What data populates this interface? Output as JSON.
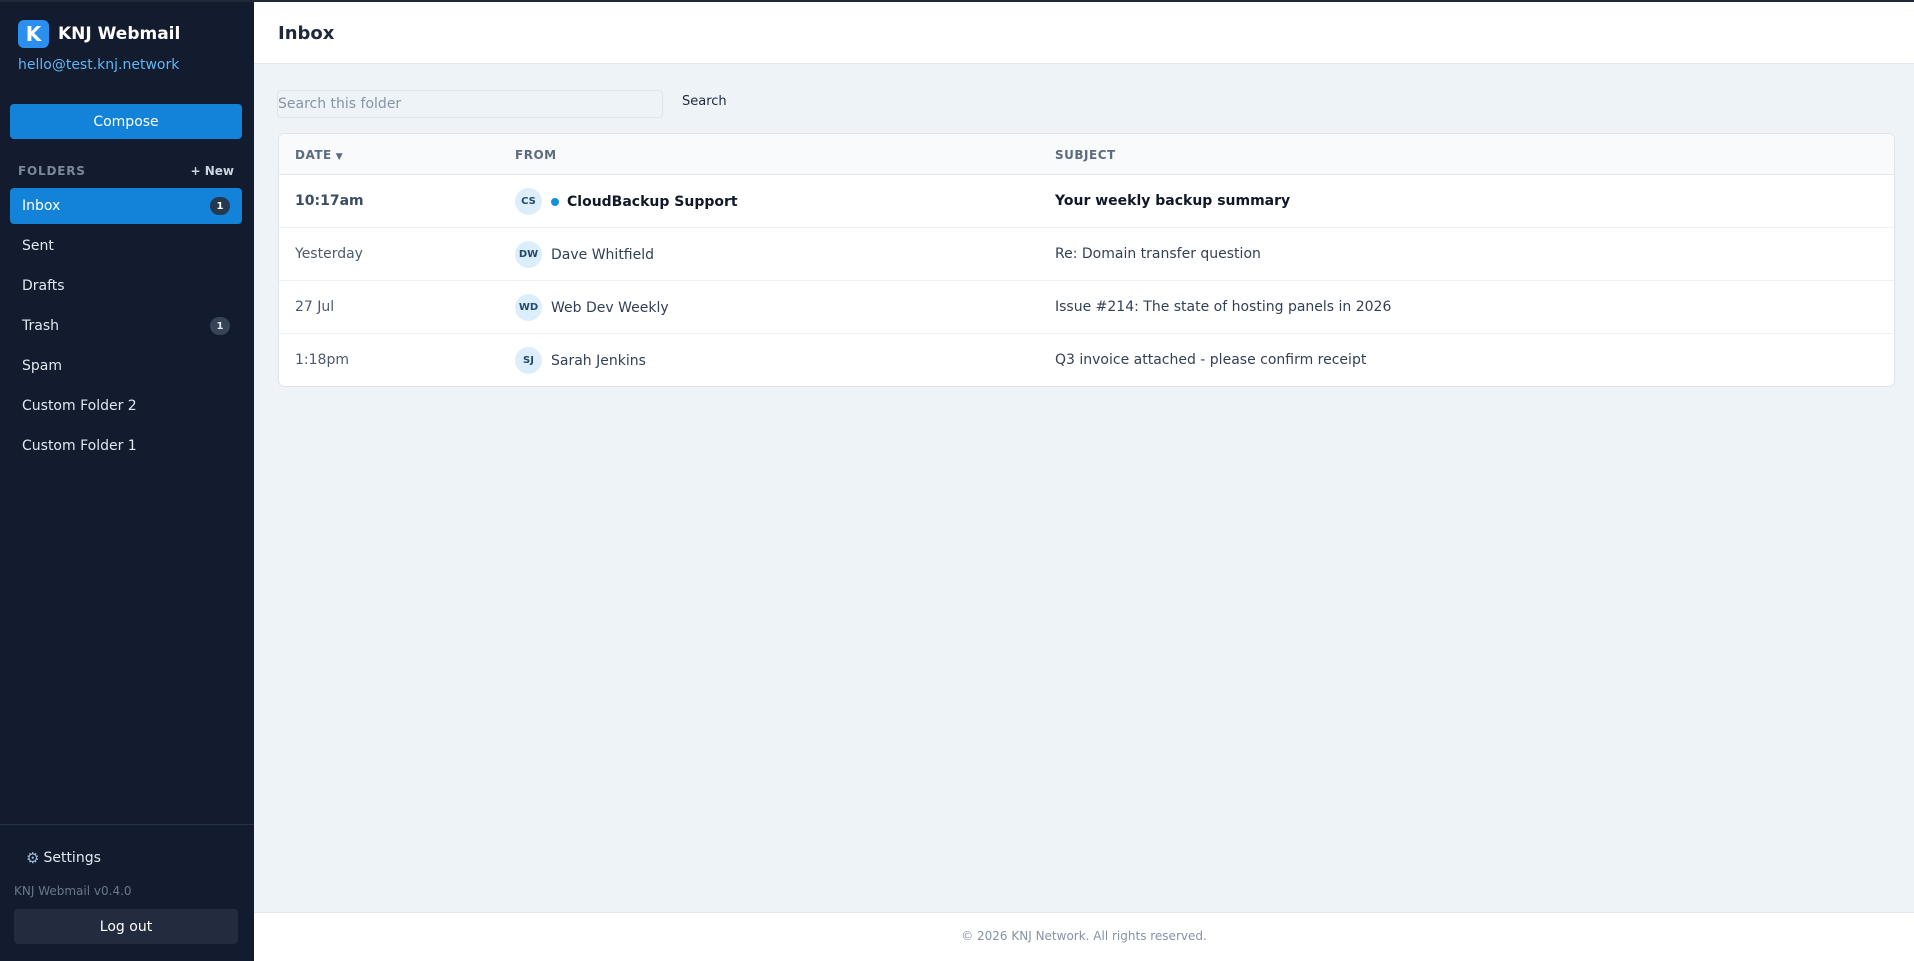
{
  "app": {
    "name": "KNJ Webmail",
    "logo_letter": "K",
    "account_email": "hello@test.knj.network",
    "version": "KNJ Webmail v0.4.0"
  },
  "sidebar": {
    "compose_label": "Compose",
    "folders_label": "FOLDERS",
    "new_folder_label": "+ New",
    "folders": [
      {
        "label": "Inbox",
        "count": "1",
        "active": true
      },
      {
        "label": "Sent",
        "count": null,
        "active": false
      },
      {
        "label": "Drafts",
        "count": null,
        "active": false
      },
      {
        "label": "Trash",
        "count": "1",
        "active": false
      },
      {
        "label": "Spam",
        "count": null,
        "active": false
      },
      {
        "label": "Custom Folder 2",
        "count": null,
        "active": false
      },
      {
        "label": "Custom Folder 1",
        "count": null,
        "active": false
      }
    ],
    "settings_label": "Settings",
    "logout_label": "Log out"
  },
  "header": {
    "title": "Inbox"
  },
  "search": {
    "placeholder": "Search this folder",
    "value": "",
    "button_label": "Search"
  },
  "table": {
    "columns": {
      "date": "DATE",
      "sort_indicator": "▼",
      "from": "FROM",
      "subject": "SUBJECT"
    },
    "rows": [
      {
        "date": "10:17am",
        "initials": "CS",
        "from": "CloudBackup Support",
        "subject": "Your weekly backup summary",
        "unread": true
      },
      {
        "date": "Yesterday",
        "initials": "DW",
        "from": "Dave Whitfield",
        "subject": "Re: Domain transfer question",
        "unread": false
      },
      {
        "date": "27 Jul",
        "initials": "WD",
        "from": "Web Dev Weekly",
        "subject": "Issue #214: The state of hosting panels in 2026",
        "unread": false
      },
      {
        "date": "1:18pm",
        "initials": "SJ",
        "from": "Sarah Jenkins",
        "subject": "Q3 invoice attached - please confirm receipt",
        "unread": false
      }
    ]
  },
  "footer": {
    "text": "© 2026 KNJ Network. All rights reserved."
  },
  "colors": {
    "sidebar_bg": "#131b2e",
    "accent": "#1283d8",
    "unread_dot": "#1590e0",
    "account_link": "#5fb6f5"
  },
  "icons": {
    "logo": "knj-logo-icon",
    "settings": "gear-icon",
    "unread": "unread-dot-icon"
  }
}
